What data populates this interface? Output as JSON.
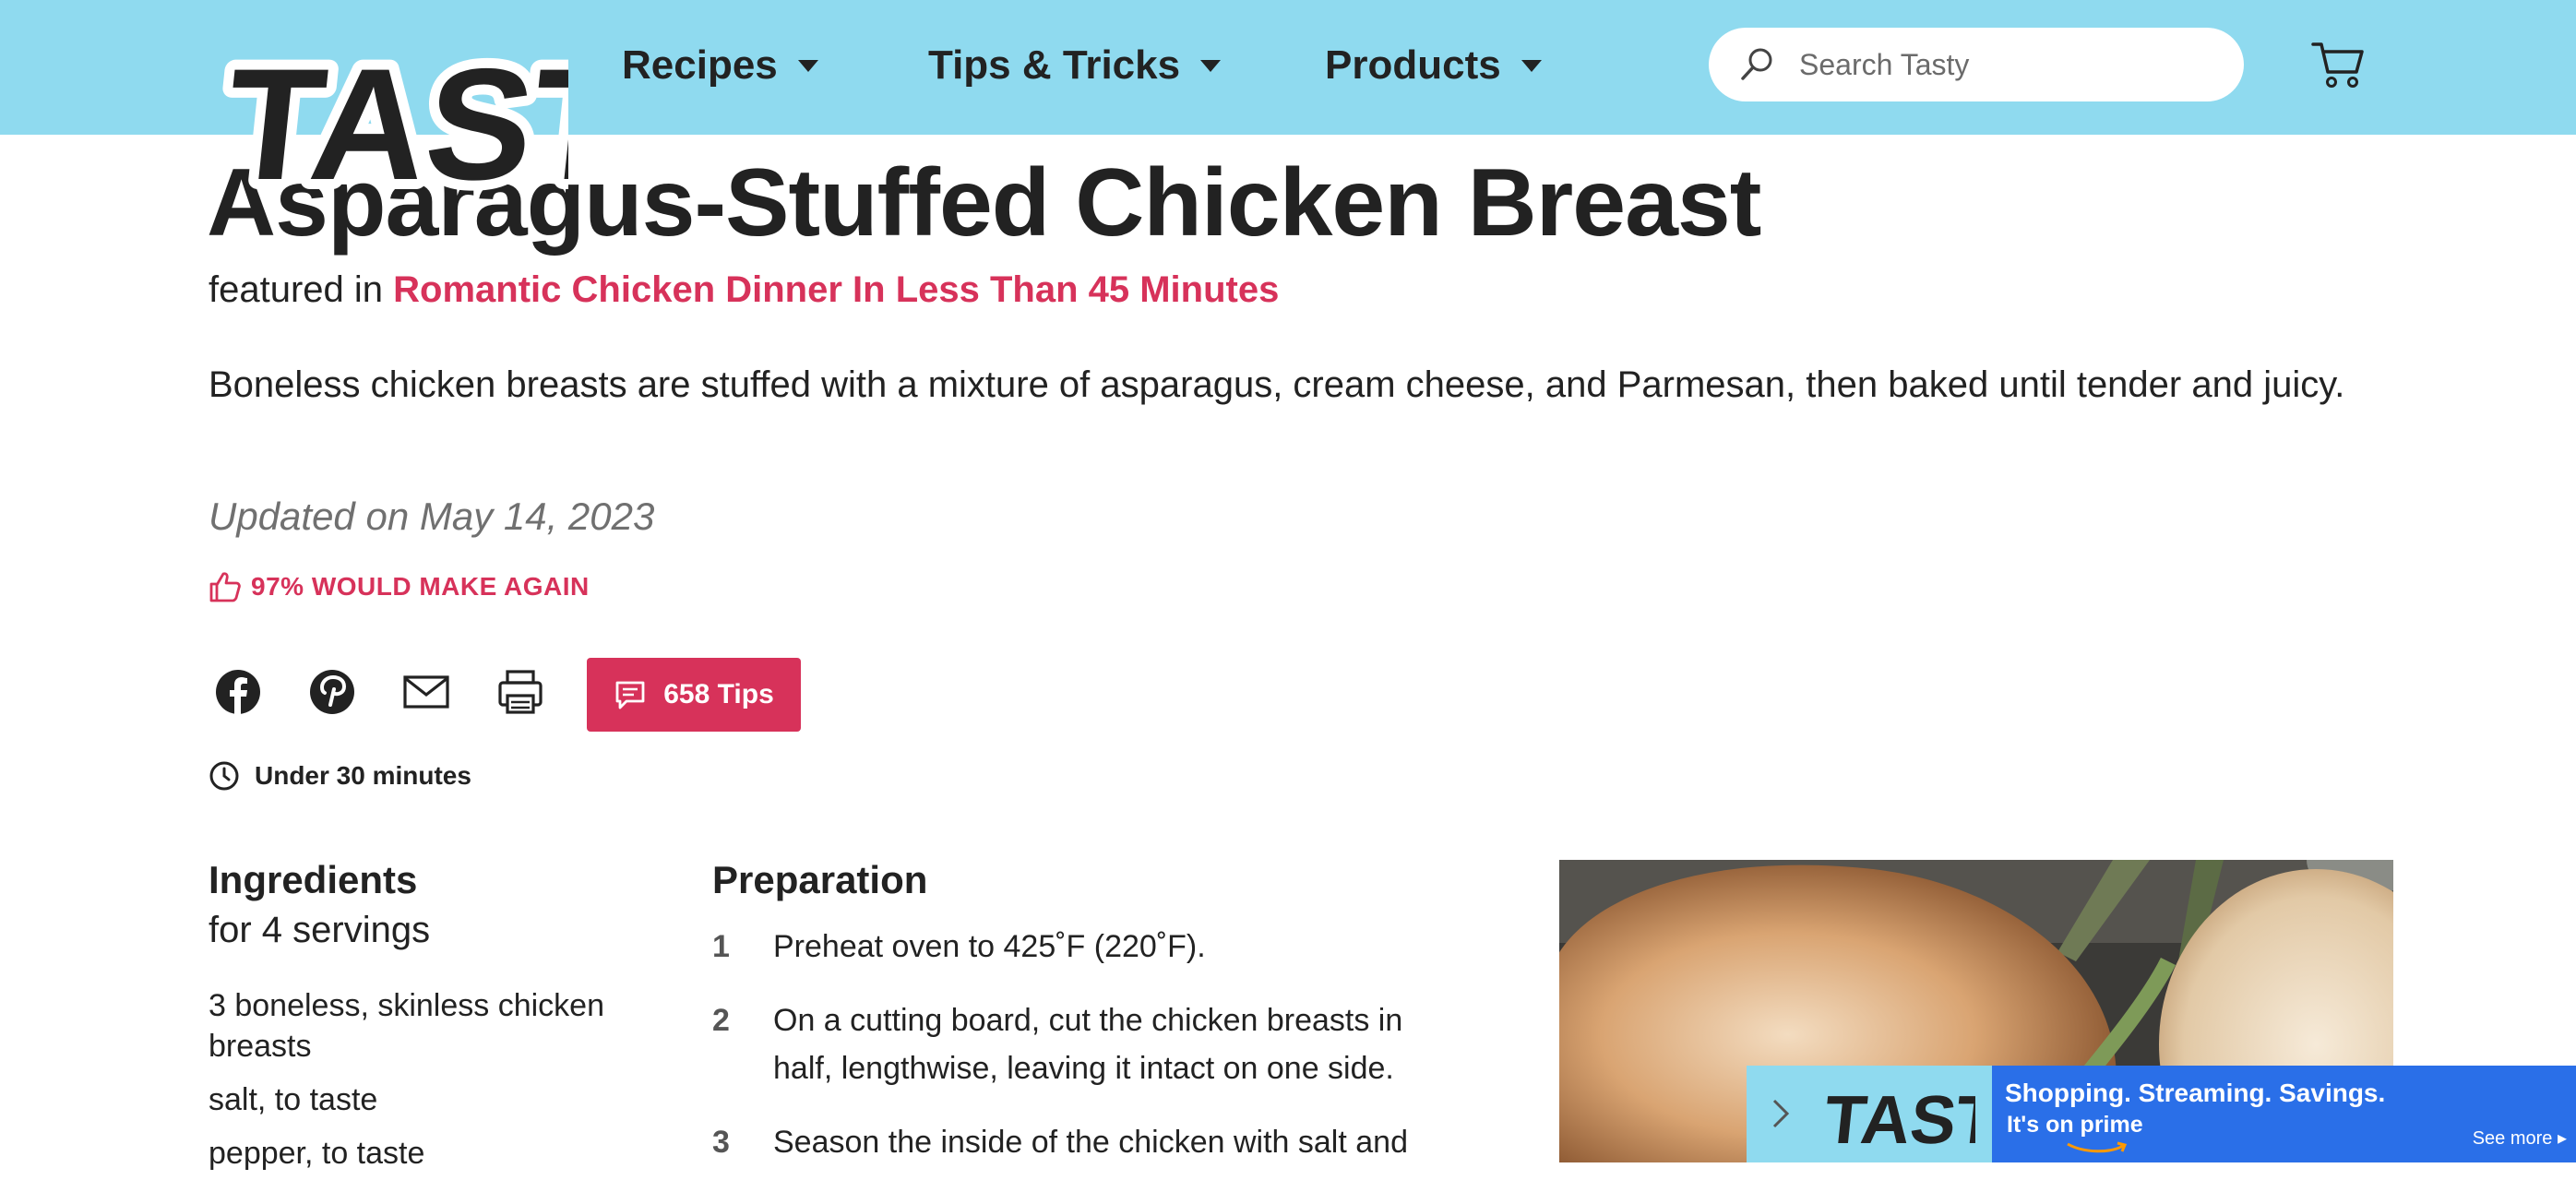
{
  "header": {
    "brand": "TASTY",
    "nav": [
      {
        "label": "Recipes"
      },
      {
        "label": "Tips & Tricks"
      },
      {
        "label": "Products"
      }
    ],
    "search_placeholder": "Search Tasty",
    "background": "#8fdaef"
  },
  "recipe": {
    "title": "Asparagus-Stuffed Chicken Breast",
    "featured_prefix": "featured in",
    "featured_link": "Romantic Chicken Dinner In Less Than 45 Minutes",
    "description": "Boneless chicken breasts are stuffed with a mixture of asparagus, cream cheese, and Parmesan, then baked until tender and juicy.",
    "updated": "Updated on May 14, 2023",
    "rating": "97% WOULD MAKE AGAIN",
    "tips_label": "658 Tips",
    "time": "Under 30 minutes",
    "accent": "#d7325a"
  },
  "ingredients": {
    "heading": "Ingredients",
    "servings": "for 4 servings",
    "items": [
      "3 boneless, skinless chicken breasts",
      "salt, to taste",
      "pepper, to taste"
    ]
  },
  "preparation": {
    "heading": "Preparation",
    "steps": [
      {
        "num": "1",
        "text": "Preheat oven to 425˚F (220˚F)."
      },
      {
        "num": "2",
        "text": "On a cutting board, cut the chicken breasts in half, lengthwise, leaving it intact on one side."
      },
      {
        "num": "3",
        "text": "Season the inside of the chicken with salt and"
      }
    ]
  },
  "ad": {
    "brand": "TASTY",
    "headline": "Shopping. Streaming. Savings.",
    "sub": "It's on prime",
    "more": "See more ▸",
    "color": "#2a6fe8"
  }
}
